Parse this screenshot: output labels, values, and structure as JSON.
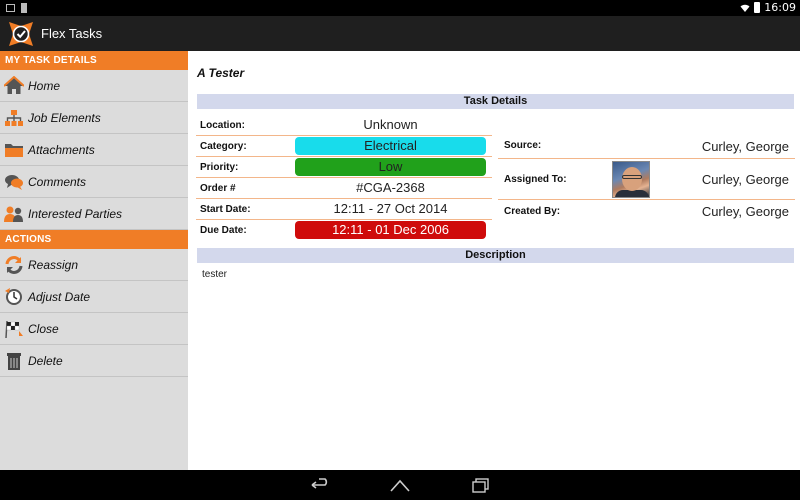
{
  "status_bar": {
    "time": "16:09"
  },
  "app": {
    "title": "Flex Tasks"
  },
  "sidebar": {
    "sections": [
      {
        "header": "MY TASK DETAILS",
        "items": [
          {
            "label": "Home",
            "icon": "home-icon"
          },
          {
            "label": "Job Elements",
            "icon": "hierarchy-icon"
          },
          {
            "label": "Attachments",
            "icon": "folder-icon"
          },
          {
            "label": "Comments",
            "icon": "comments-icon"
          },
          {
            "label": "Interested Parties",
            "icon": "people-icon"
          }
        ]
      },
      {
        "header": "ACTIONS",
        "items": [
          {
            "label": "Reassign",
            "icon": "reassign-icon"
          },
          {
            "label": "Adjust Date",
            "icon": "clock-icon"
          },
          {
            "label": "Close",
            "icon": "checkered-flag-icon"
          },
          {
            "label": "Delete",
            "icon": "trash-icon"
          }
        ]
      }
    ]
  },
  "task": {
    "title": "A Tester",
    "details_header": "Task Details",
    "left_fields": [
      {
        "label": "Location:",
        "value": "Unknown"
      },
      {
        "label": "Category:",
        "value": "Electrical"
      },
      {
        "label": "Priority:",
        "value": "Low"
      },
      {
        "label": "Order #",
        "value": "#CGA-2368"
      },
      {
        "label": "Start Date:",
        "value": "12:11 - 27 Oct 2014"
      },
      {
        "label": "Due Date:",
        "value": "12:11 - 01 Dec 2006"
      }
    ],
    "right_fields": [
      {
        "label": "Source:",
        "value": "Curley, George"
      },
      {
        "label": "Assigned To:",
        "value": "Curley, George"
      },
      {
        "label": "Created By:",
        "value": "Curley, George"
      }
    ],
    "description_header": "Description",
    "description": "tester"
  },
  "colors": {
    "accent": "#f07d26",
    "category_pill": "#18dceb",
    "priority_pill": "#21a11b",
    "due_date_pill": "#cf0b0b",
    "band": "#d3d8ec"
  }
}
